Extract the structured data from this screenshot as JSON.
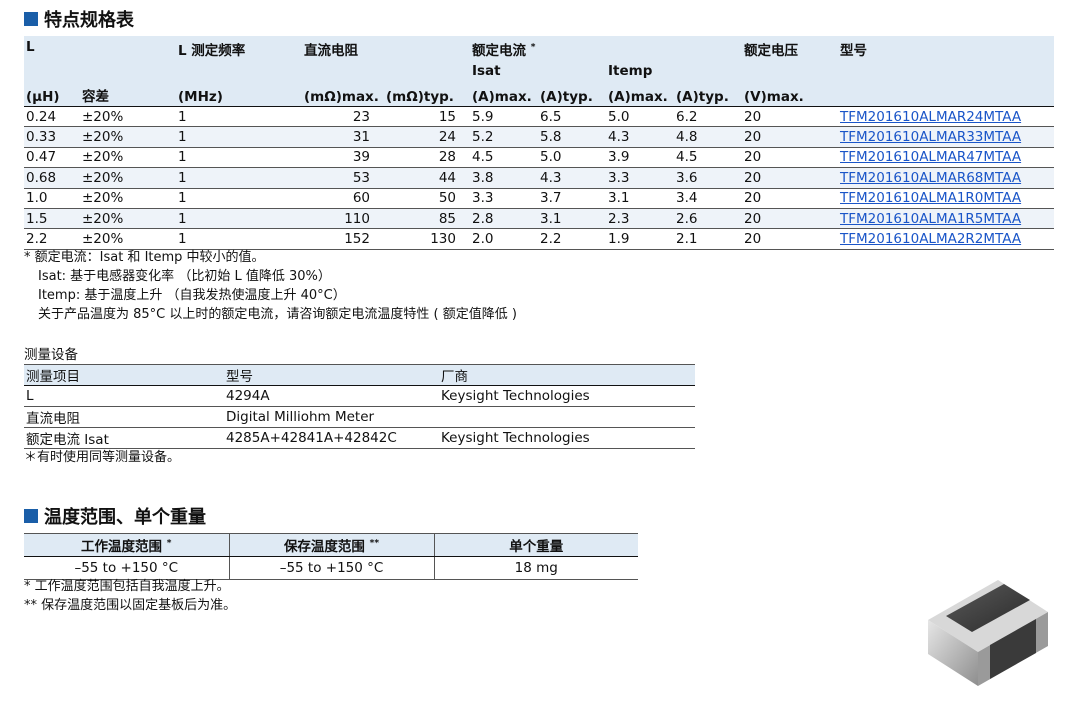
{
  "section1": {
    "title": "特点规格表"
  },
  "spec": {
    "headers": {
      "L": "L",
      "freq": "L 测定频率",
      "dcr": "直流电阻",
      "rated_current": "额定电流",
      "rated_current_mark": "*",
      "isat": "Isat",
      "itemp": "Itemp",
      "rated_voltage": "额定电压",
      "model": "型号",
      "uH": "(μH)",
      "tolerance": "容差",
      "mhz": "(MHz)",
      "mohm_max": "(mΩ)max.",
      "mohm_typ": "(mΩ)typ.",
      "isat_max": "(A)max.",
      "isat_typ": "(A)typ.",
      "itemp_max": "(A)max.",
      "itemp_typ": "(A)typ.",
      "v_max": "(V)max."
    },
    "rows": [
      {
        "L": "0.24",
        "tol": "±20%",
        "f": "1",
        "dcr_max": "23",
        "dcr_typ": "15",
        "isat_max": "5.9",
        "isat_typ": "6.5",
        "itemp_max": "5.0",
        "itemp_typ": "6.2",
        "v": "20",
        "pn": "TFM201610ALMAR24MTAA"
      },
      {
        "L": "0.33",
        "tol": "±20%",
        "f": "1",
        "dcr_max": "31",
        "dcr_typ": "24",
        "isat_max": "5.2",
        "isat_typ": "5.8",
        "itemp_max": "4.3",
        "itemp_typ": "4.8",
        "v": "20",
        "pn": "TFM201610ALMAR33MTAA"
      },
      {
        "L": "0.47",
        "tol": "±20%",
        "f": "1",
        "dcr_max": "39",
        "dcr_typ": "28",
        "isat_max": "4.5",
        "isat_typ": "5.0",
        "itemp_max": "3.9",
        "itemp_typ": "4.5",
        "v": "20",
        "pn": "TFM201610ALMAR47MTAA"
      },
      {
        "L": "0.68",
        "tol": "±20%",
        "f": "1",
        "dcr_max": "53",
        "dcr_typ": "44",
        "isat_max": "3.8",
        "isat_typ": "4.3",
        "itemp_max": "3.3",
        "itemp_typ": "3.6",
        "v": "20",
        "pn": "TFM201610ALMAR68MTAA"
      },
      {
        "L": "1.0",
        "tol": "±20%",
        "f": "1",
        "dcr_max": "60",
        "dcr_typ": "50",
        "isat_max": "3.3",
        "isat_typ": "3.7",
        "itemp_max": "3.1",
        "itemp_typ": "3.4",
        "v": "20",
        "pn": "TFM201610ALMA1R0MTAA"
      },
      {
        "L": "1.5",
        "tol": "±20%",
        "f": "1",
        "dcr_max": "110",
        "dcr_typ": "85",
        "isat_max": "2.8",
        "isat_typ": "3.1",
        "itemp_max": "2.3",
        "itemp_typ": "2.6",
        "v": "20",
        "pn": "TFM201610ALMA1R5MTAA"
      },
      {
        "L": "2.2",
        "tol": "±20%",
        "f": "1",
        "dcr_max": "152",
        "dcr_typ": "130",
        "isat_max": "2.0",
        "isat_typ": "2.2",
        "itemp_max": "1.9",
        "itemp_typ": "2.1",
        "v": "20",
        "pn": "TFM201610ALMA2R2MTAA"
      }
    ],
    "notes": [
      "* 额定电流：Isat 和 Itemp 中较小的值。",
      "Isat: 基于电感器变化率 （比初始 L 值降低 30%）",
      "Itemp: 基于温度上升 （自我发热使温度上升 40°C）",
      "关于产品温度为 85°C 以上时的额定电流，请咨询额定电流温度特性 ( 额定值降低 )"
    ]
  },
  "equipment": {
    "caption": "测量设备",
    "headers": [
      "测量项目",
      "型号",
      "厂商"
    ],
    "rows": [
      [
        "L",
        "4294A",
        "Keysight Technologies"
      ],
      [
        "直流电阻",
        "Digital Milliohm Meter",
        ""
      ],
      [
        "额定电流 Isat",
        "4285A+42841A+42842C",
        "Keysight Technologies"
      ]
    ],
    "note": "＊有时使用同等测量设备。"
  },
  "section2": {
    "title": "温度范围、单个重量"
  },
  "temp": {
    "headers": [
      "工作温度范围",
      "保存温度范围",
      "单个重量"
    ],
    "header_marks": [
      "*",
      "**",
      ""
    ],
    "values": [
      "–55 to +150 °C",
      "–55 to +150 °C",
      "18 mg"
    ],
    "notes": [
      "*  工作温度范围包括自我温度上升。",
      "** 保存温度范围以固定基板后为准。"
    ]
  }
}
